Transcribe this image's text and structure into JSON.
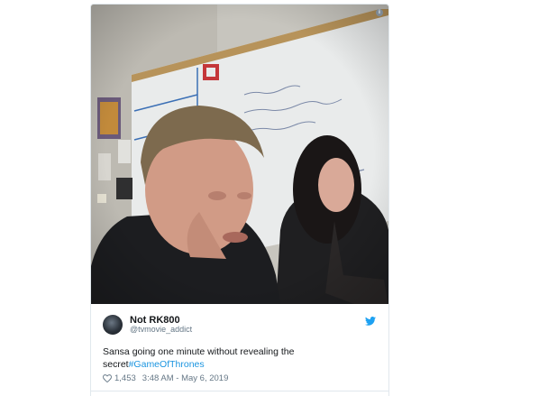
{
  "tweet": {
    "display_name": "Not RK800",
    "handle": "@tvmovie_addict",
    "text_plain": "Sansa going one minute without revealing the secret",
    "hashtag": "#GameOfThrones",
    "likes": "1,453",
    "timestamp": "3:48 AM - May 6, 2019"
  },
  "icons": {
    "info": "info-icon",
    "twitter": "twitter-bird-icon",
    "like": "heart-icon"
  },
  "colors": {
    "accent": "#1b95e0",
    "text": "#14171a",
    "muted": "#657786",
    "border": "#e1e8ed"
  }
}
